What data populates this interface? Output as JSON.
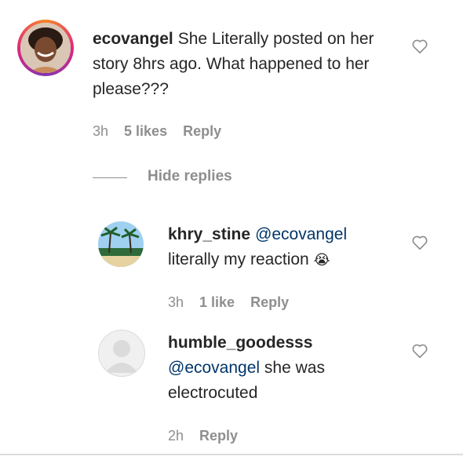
{
  "comment": {
    "username": "ecovangel",
    "text": "She Literally posted on her story 8hrs ago. What happened to her please???",
    "time": "3h",
    "likes": "5 likes",
    "reply": "Reply"
  },
  "hide_replies": "Hide replies",
  "replies": [
    {
      "username": "khry_stine",
      "mention": "@ecovangel",
      "text": "literally my reaction",
      "emoji": "😭",
      "time": "3h",
      "likes": "1 like",
      "reply": "Reply"
    },
    {
      "username": "humble_goodesss",
      "mention": "@ecovangel",
      "text": "she was electrocuted",
      "time": "2h",
      "reply": "Reply"
    }
  ],
  "colors": {
    "text": "#262626",
    "meta": "#8e8e8e",
    "mention": "#003569",
    "heart": "#8e8e8e"
  }
}
